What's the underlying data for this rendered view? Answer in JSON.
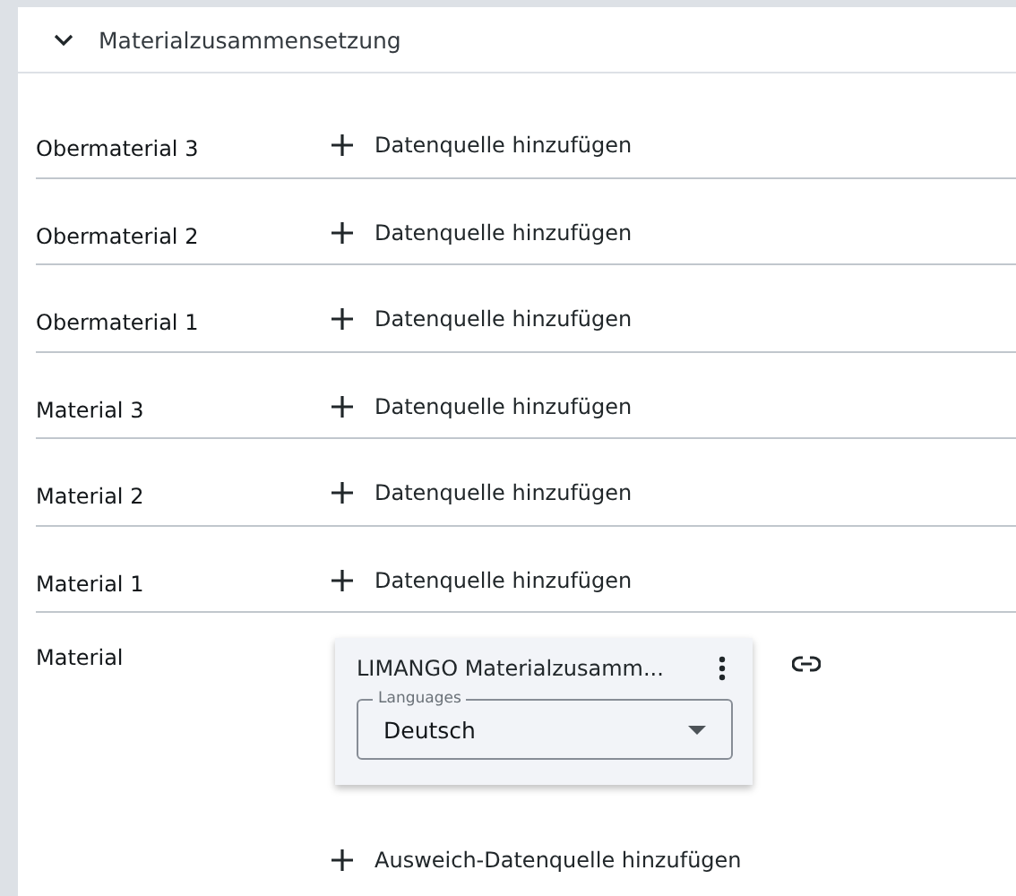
{
  "section": {
    "title": "Materialzusammensetzung",
    "expanded": true
  },
  "rows": [
    {
      "label": "Obermaterial 3",
      "action": "Datenquelle hinzufügen"
    },
    {
      "label": "Obermaterial 2",
      "action": "Datenquelle hinzufügen"
    },
    {
      "label": "Obermaterial 1",
      "action": "Datenquelle hinzufügen"
    },
    {
      "label": "Material 3",
      "action": "Datenquelle hinzufügen"
    },
    {
      "label": "Material 2",
      "action": "Datenquelle hinzufügen"
    },
    {
      "label": "Material 1",
      "action": "Datenquelle hinzufügen"
    }
  ],
  "material": {
    "label": "Material",
    "card_title": "LIMANGO Materialzusamm...",
    "select": {
      "label": "Languages",
      "value": "Deutsch"
    },
    "fallback_action": "Ausweich-Datenquelle hinzufügen"
  }
}
